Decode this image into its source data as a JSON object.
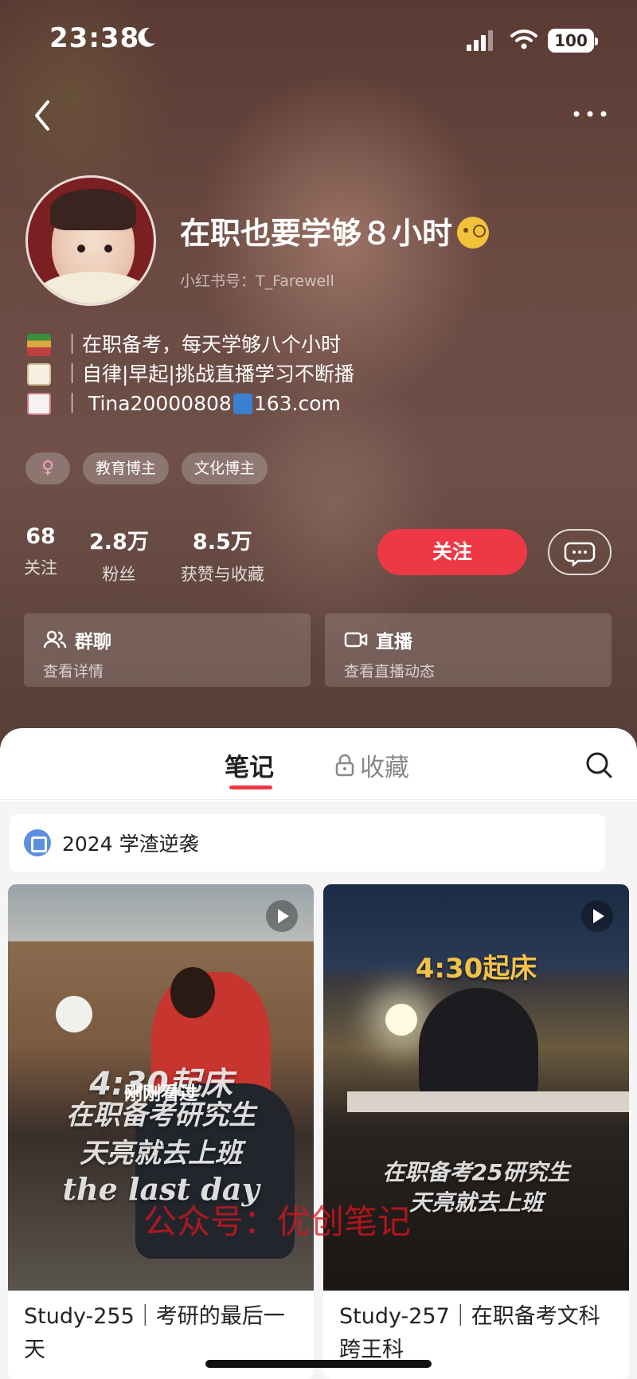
{
  "status_bar": {
    "time": "23:38",
    "battery": "100"
  },
  "profile": {
    "nickname": "在职也要学够８小时",
    "user_id": "小红书号：T_Farewell",
    "bio": [
      "｜在职备考，每天学够八个小时",
      "｜自律|早起|挑战直播学习不断播",
      "｜ Tina20000808",
      "163.com"
    ],
    "tags": {
      "gender": "♀",
      "tag1": "教育博主",
      "tag2": "文化博主"
    },
    "stats": [
      {
        "num": "68",
        "label": "关注"
      },
      {
        "num": "2.8万",
        "label": "粉丝"
      },
      {
        "num": "8.5万",
        "label": "获赞与收藏"
      }
    ],
    "follow_label": "关注",
    "cards": {
      "group": {
        "title": "群聊",
        "sub": "查看详情"
      },
      "live": {
        "title": "直播",
        "sub": "查看直播动态"
      }
    }
  },
  "tabs": {
    "notes": "笔记",
    "collect": "收藏"
  },
  "collection": {
    "title": "2024 学渣逆袭"
  },
  "notes": [
    {
      "overlay_time": "4:30起床",
      "overlay_line1": "在职备考研究生",
      "overlay_line2": "天亮就去上班",
      "overlay_eng": "the last day",
      "badge": "刚刚看过",
      "title": "Study-255｜考研的最后一天"
    },
    {
      "overlay_time": "4:30起床",
      "overlay_line1": "在职备考25研究生",
      "overlay_line2": "天亮就去上班",
      "title": "Study-257｜在职备考文科跨王科"
    }
  ],
  "watermark": "公众号：优创笔记",
  "colors": {
    "accent": "#ee3846",
    "hero_bg": "#6b4a42"
  },
  "icons": [
    "moon-icon",
    "signal-icon",
    "wifi-icon",
    "back-icon",
    "more-icon",
    "chat-icon",
    "group-icon",
    "video-icon",
    "lock-icon",
    "search-icon",
    "play-icon"
  ]
}
